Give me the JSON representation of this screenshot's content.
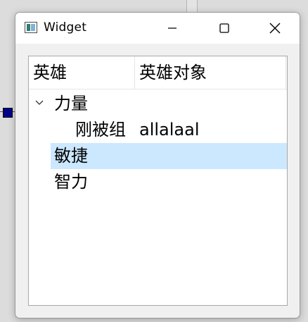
{
  "window": {
    "title": "Widget",
    "icon": "app-window-icon",
    "controls": [
      "minimize-icon",
      "maximize-icon",
      "close-icon"
    ]
  },
  "tree": {
    "columns": [
      "英雄",
      "英雄对象"
    ],
    "rows": [
      {
        "label": "力量",
        "value": "",
        "expanded": true,
        "level": 0
      },
      {
        "label": "刚被组",
        "value": "allalaal",
        "level": 1
      },
      {
        "label": "敏捷",
        "value": "",
        "level": 0,
        "selected": true
      },
      {
        "label": "智力",
        "value": "",
        "level": 0
      }
    ]
  },
  "colors": {
    "selection": "#cce8ff",
    "window_bg": "#f0f0f0",
    "titlebar_bg": "#ffffff"
  }
}
